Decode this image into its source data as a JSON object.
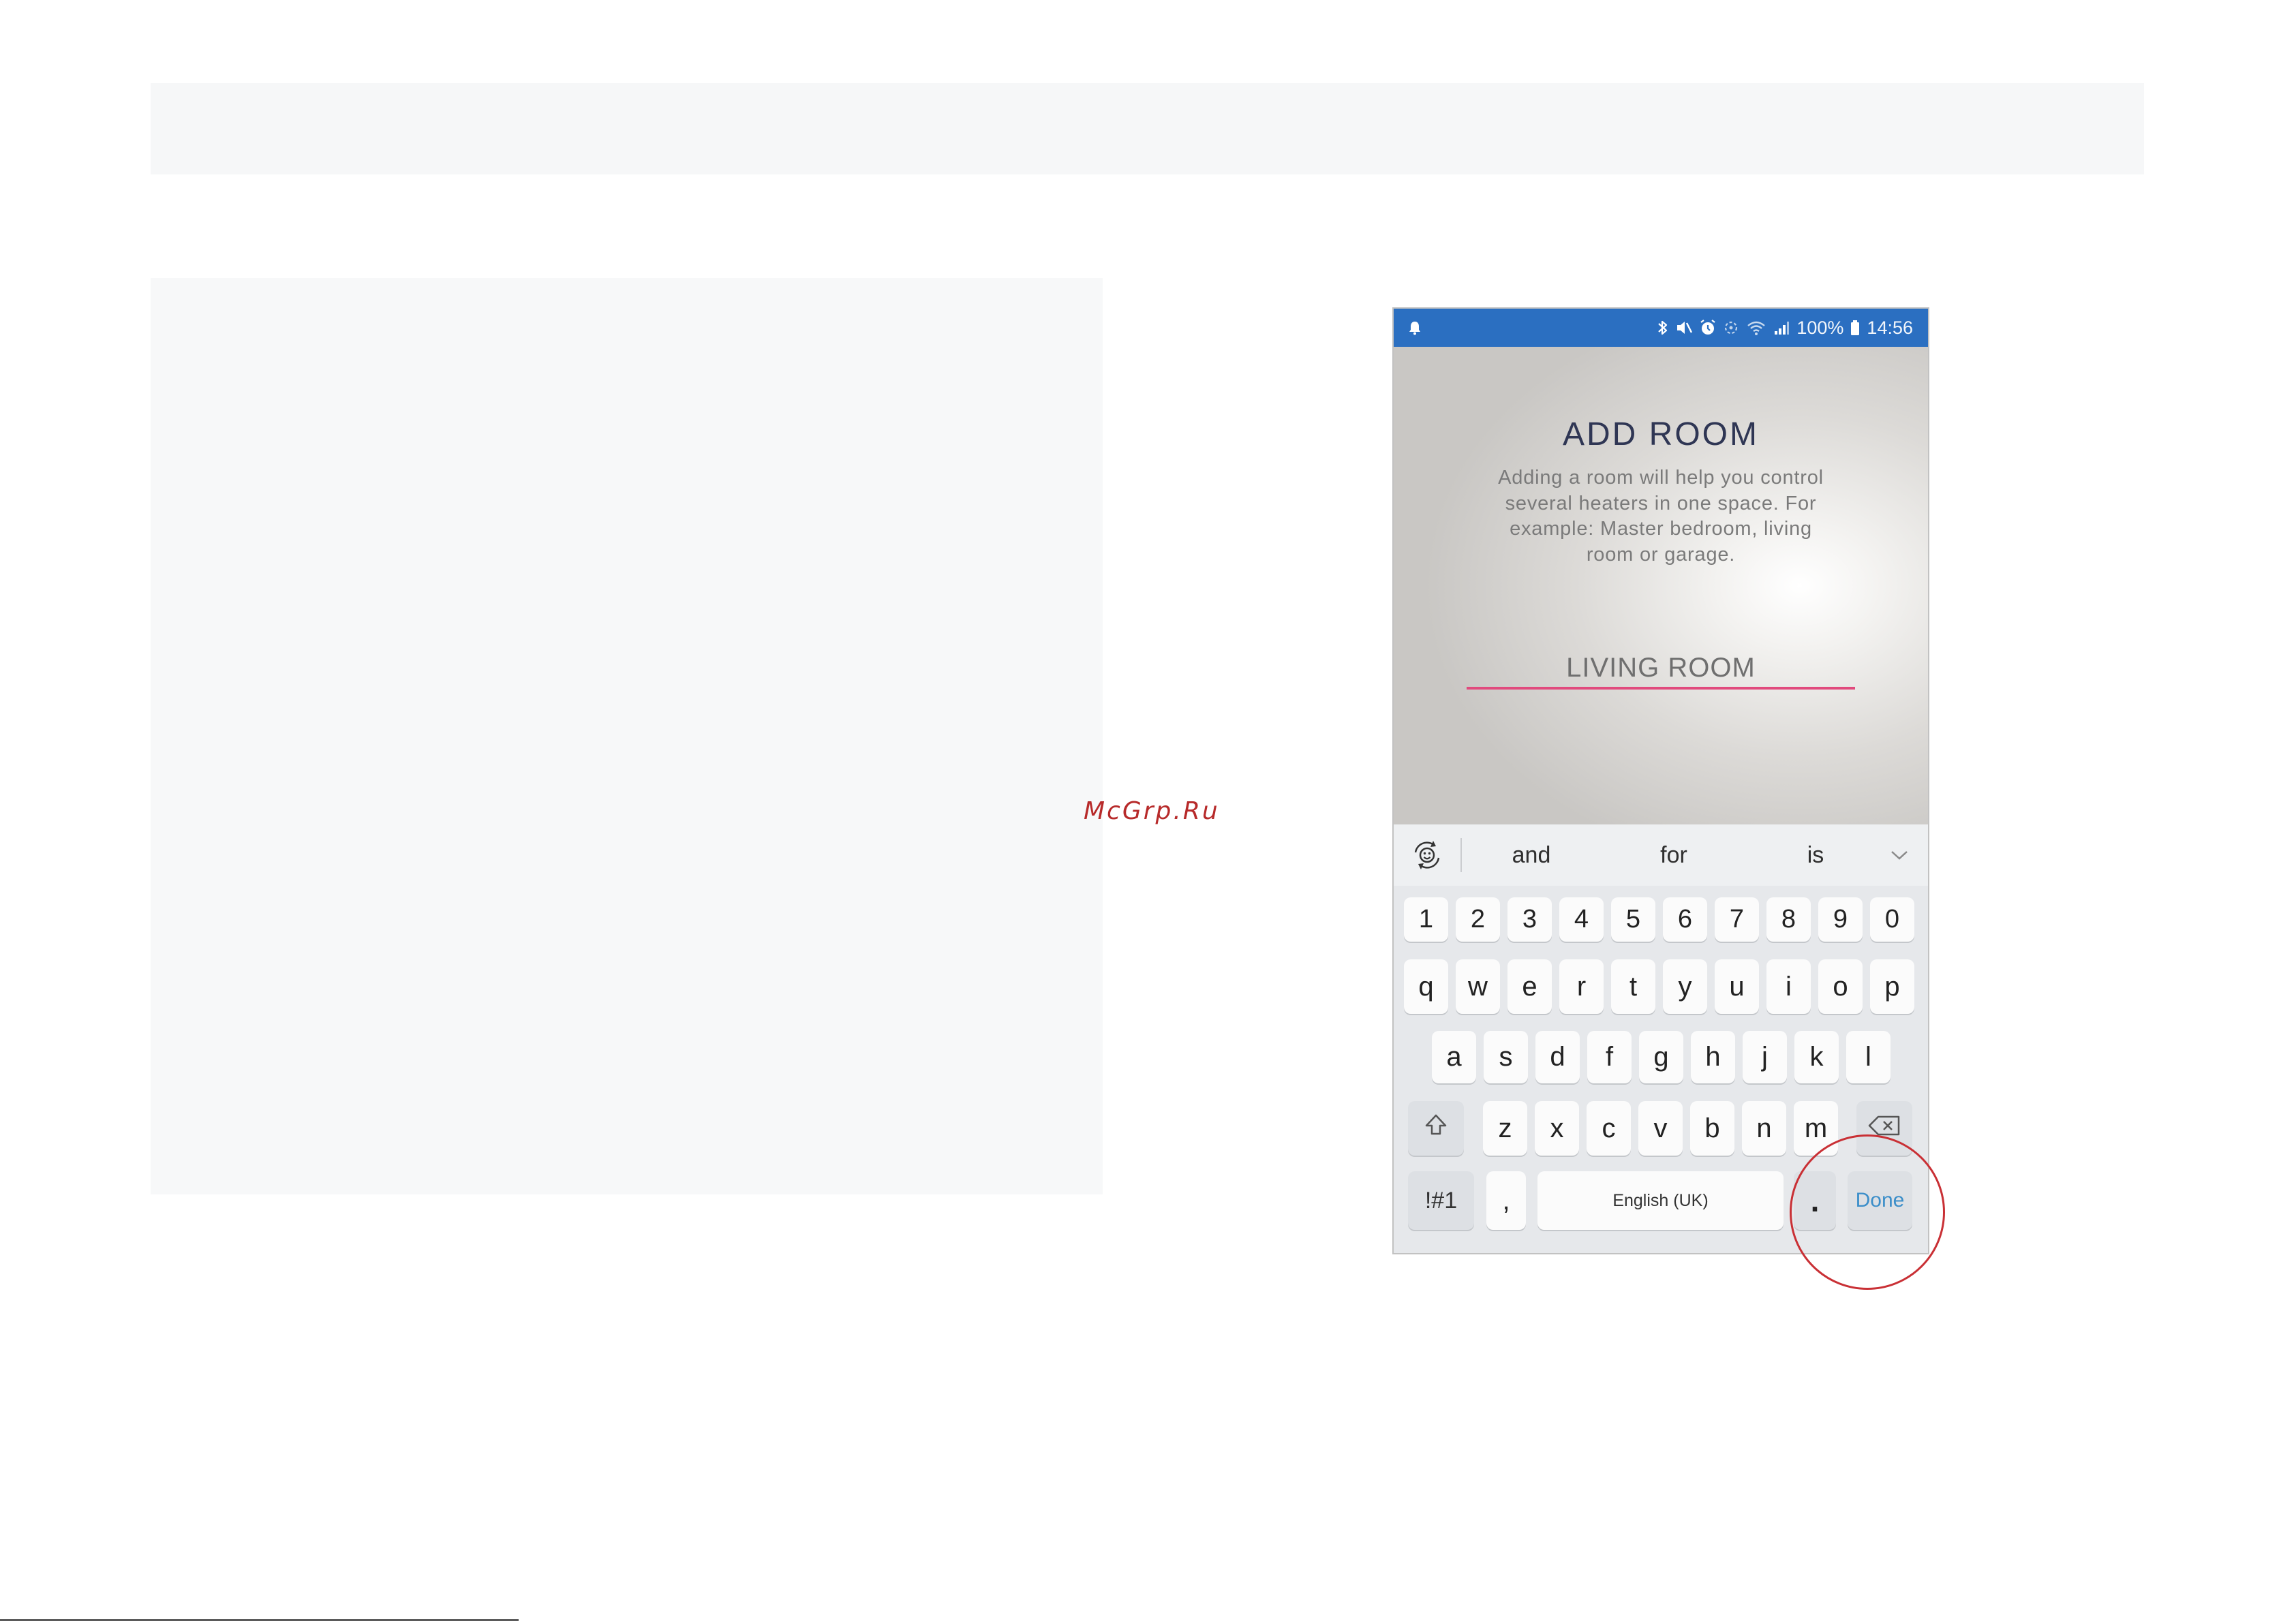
{
  "watermark": "McGrp.Ru",
  "phone": {
    "status_bar": {
      "left_icons": [
        "notification-icon"
      ],
      "right_icons": [
        "bluetooth-icon",
        "mute-icon",
        "alarm-icon",
        "data-saver-icon",
        "wifi-icon",
        "signal-icon"
      ],
      "battery_percent": "100%",
      "battery_icon": "battery-icon",
      "time": "14:56"
    },
    "screen": {
      "title": "ADD ROOM",
      "description_lines": [
        "Adding a room will help you control",
        "several heaters in one space. For",
        "example: Master bedroom, living",
        "room or garage."
      ],
      "room_name_input": {
        "value": "LIVING ROOM"
      }
    },
    "keyboard": {
      "toggle_icon": "emoji-cycle-icon",
      "suggestions": [
        "and",
        "for",
        "is"
      ],
      "collapse_icon": "chevron-down-icon",
      "number_row": [
        "1",
        "2",
        "3",
        "4",
        "5",
        "6",
        "7",
        "8",
        "9",
        "0"
      ],
      "letter_row_1": [
        "q",
        "w",
        "e",
        "r",
        "t",
        "y",
        "u",
        "i",
        "o",
        "p"
      ],
      "letter_row_2": [
        "a",
        "s",
        "d",
        "f",
        "g",
        "h",
        "j",
        "k",
        "l"
      ],
      "letter_row_3": [
        "z",
        "x",
        "c",
        "v",
        "b",
        "n",
        "m"
      ],
      "shift_icon": "shift-icon",
      "backspace_icon": "backspace-icon",
      "symbols_key": "!#1",
      "comma_key": ",",
      "space_key": "English (UK)",
      "period_key": ".",
      "done_key": "Done"
    }
  },
  "colors": {
    "status_bar": "#2b6fc1",
    "accent_underline": "#e14a7d",
    "done_text": "#3b8ec9",
    "highlight_circle": "#c93035",
    "watermark": "#b72a2a",
    "title": "#2f3654"
  }
}
